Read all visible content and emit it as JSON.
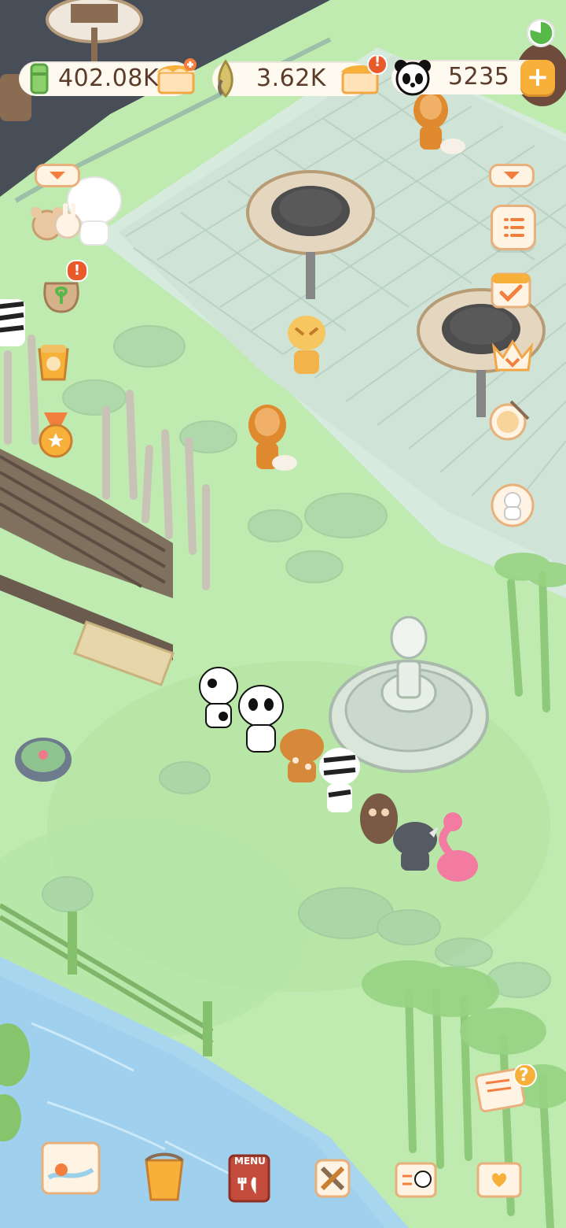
{
  "hud": {
    "currency1": {
      "value": "402.08K",
      "icon": "bamboo-coin-icon"
    },
    "currency2": {
      "value": "3.62K",
      "icon": "bamboo-shoot-icon"
    },
    "currency3": {
      "value": "5235",
      "icon": "panda-icon"
    },
    "plus_label": "+",
    "alert_badge": "!"
  },
  "left_buttons": [
    {
      "name": "collapse-left-chip",
      "icon": "chevron-down-icon"
    },
    {
      "name": "animal-friends-button",
      "icon": "bear-bunny-icon"
    },
    {
      "name": "seed-bag-button",
      "icon": "seed-bag-icon",
      "badge": "!"
    },
    {
      "name": "gift-pot-button",
      "icon": "gift-pot-icon"
    },
    {
      "name": "medal-button",
      "icon": "medal-icon"
    }
  ],
  "right_buttons": [
    {
      "name": "collapse-right-chip",
      "icon": "chevron-down-icon"
    },
    {
      "name": "task-list-button",
      "icon": "list-icon"
    },
    {
      "name": "calendar-check-button",
      "icon": "calendar-check-icon"
    },
    {
      "name": "crown-button",
      "icon": "crown-icon"
    },
    {
      "name": "drum-button",
      "icon": "drum-icon"
    },
    {
      "name": "visitor-avatar-button",
      "icon": "visitor-avatar-icon"
    }
  ],
  "bottom_bar": [
    {
      "name": "map-button",
      "icon": "map-icon"
    },
    {
      "name": "paint-bucket-button",
      "icon": "paint-bucket-icon"
    },
    {
      "name": "menu-book-button",
      "icon": "menu-book-icon",
      "text": "MENU"
    },
    {
      "name": "tools-button",
      "icon": "tools-icon"
    },
    {
      "name": "panda-id-button",
      "icon": "id-card-icon"
    },
    {
      "name": "storage-box-button",
      "icon": "storage-box-icon"
    }
  ],
  "help_note": {
    "icon": "help-note-icon",
    "badge": "?"
  },
  "colors": {
    "grass": "#bfeab0",
    "grass_dark": "#a9e09a",
    "plaza": "#cfe3d6",
    "plaza_tiles": "#b7d1c3",
    "river": "#9fd0ee",
    "wood": "#7b6a5a",
    "accent_orange": "#f37f3e",
    "badge_red": "#e85a2a",
    "gold": "#f7b13b"
  }
}
